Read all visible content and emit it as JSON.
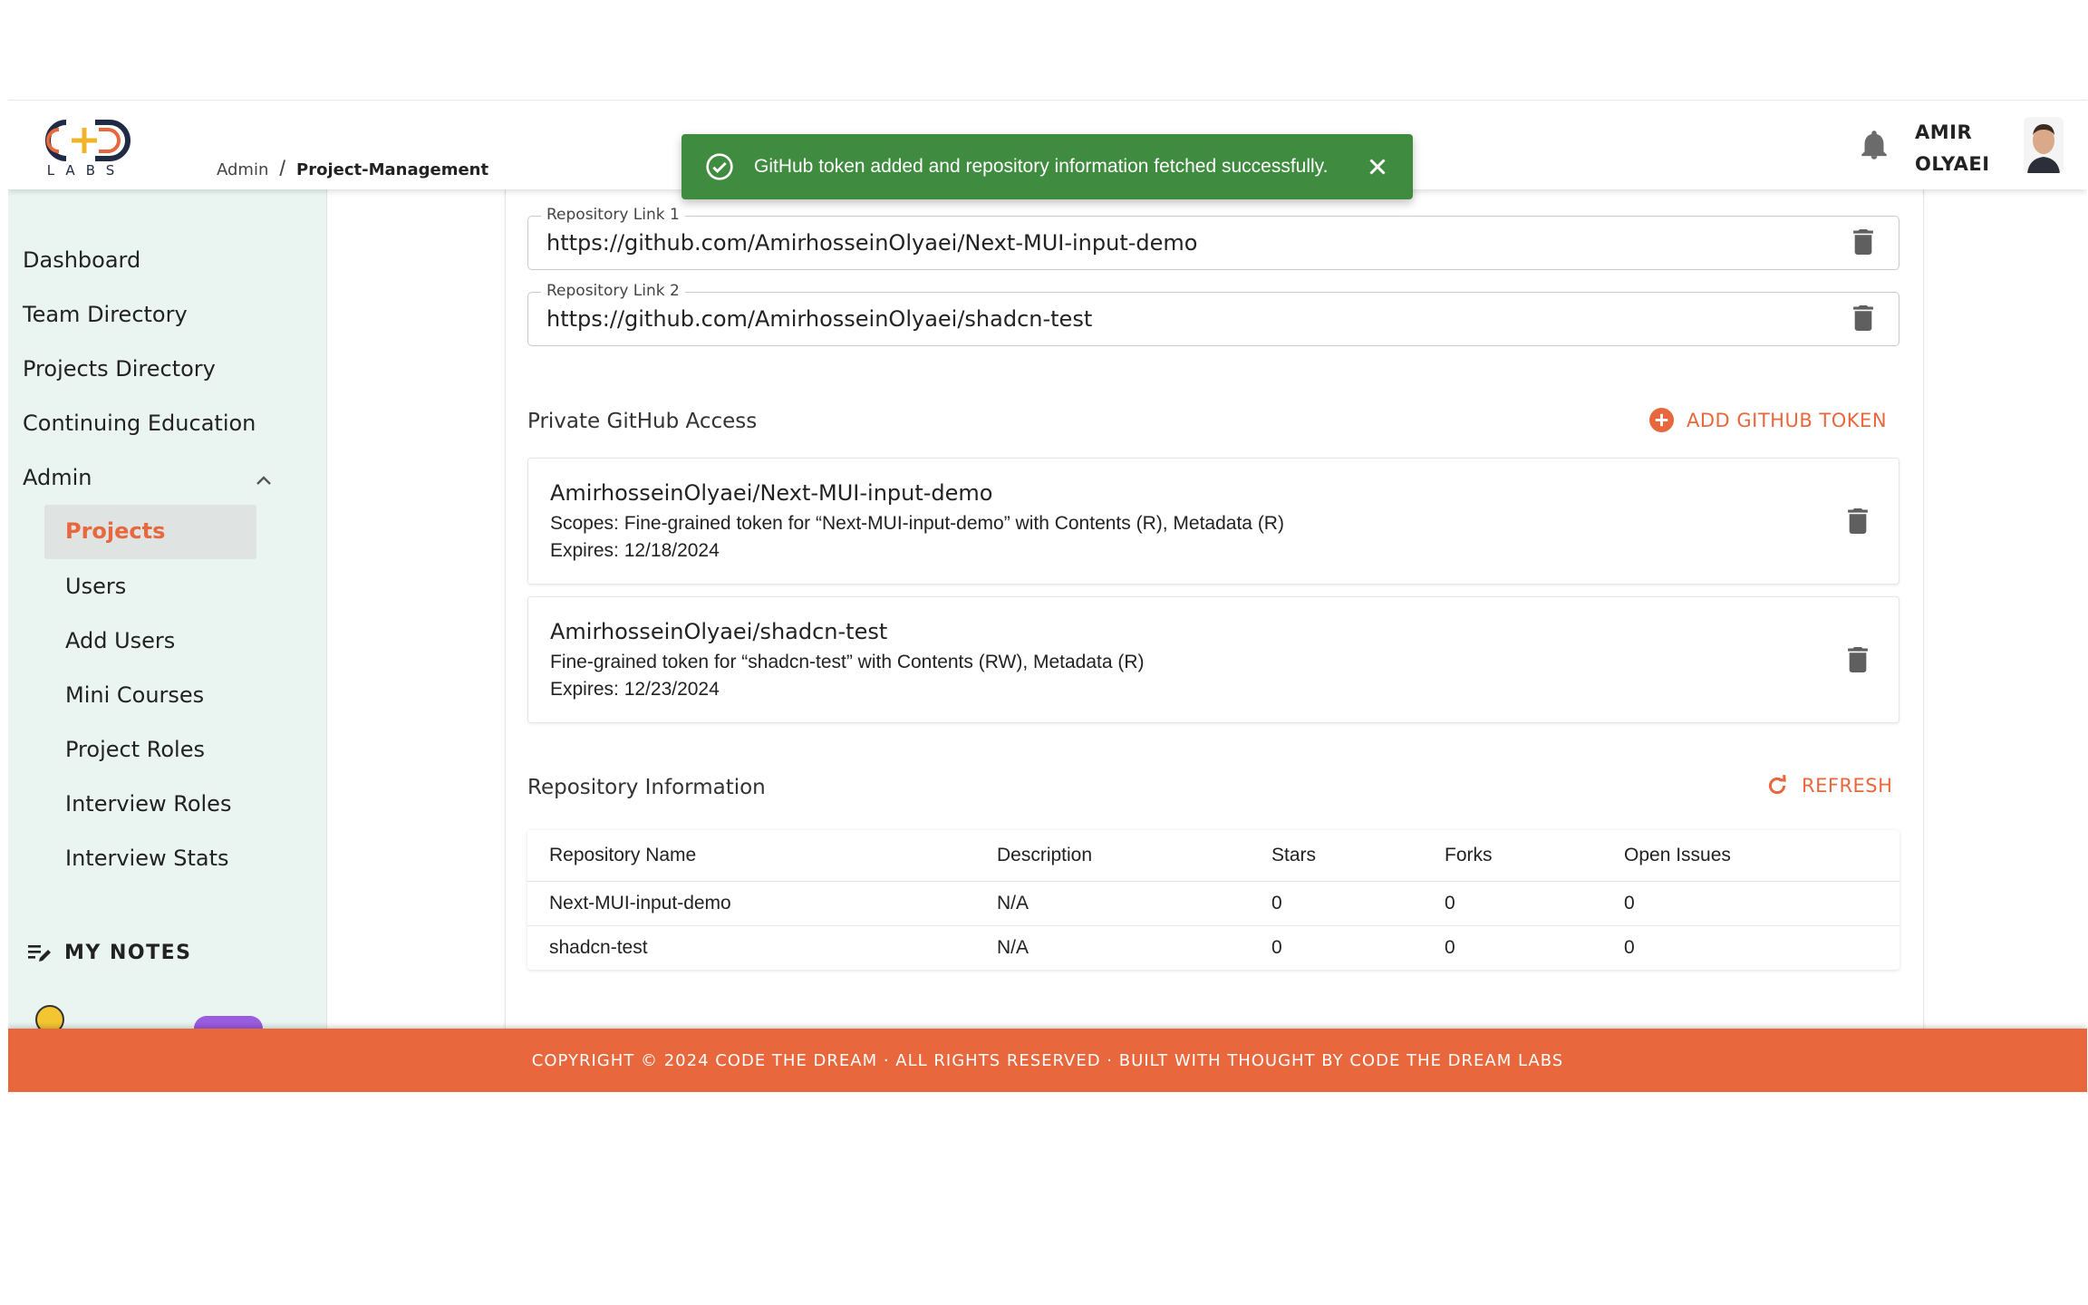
{
  "header": {
    "logo_text": "LABS",
    "breadcrumb": [
      "Admin",
      "Project-Management"
    ],
    "breadcrumb_separator": "/",
    "user_name": "AMIR OLYAEI"
  },
  "toast": {
    "message": "GitHub token added and repository information fetched successfully.",
    "color": "#3f8b3f"
  },
  "sidebar": {
    "items": [
      {
        "label": "Dashboard"
      },
      {
        "label": "Team Directory"
      },
      {
        "label": "Projects Directory"
      },
      {
        "label": "Continuing Education"
      },
      {
        "label": "Admin"
      }
    ],
    "admin_items": [
      {
        "label": "Projects",
        "active": true
      },
      {
        "label": "Users"
      },
      {
        "label": "Add Users"
      },
      {
        "label": "Mini Courses"
      },
      {
        "label": "Project Roles"
      },
      {
        "label": "Interview Roles"
      },
      {
        "label": "Interview Stats"
      }
    ],
    "notes_label": "MY NOTES"
  },
  "repo_links": [
    {
      "label": "Repository Link 1",
      "value": "https://github.com/AmirhosseinOlyaei/Next-MUI-input-demo"
    },
    {
      "label": "Repository Link 2",
      "value": "https://github.com/AmirhosseinOlyaei/shadcn-test"
    }
  ],
  "private_access": {
    "title": "Private GitHub Access",
    "add_button": "ADD GITHUB TOKEN",
    "tokens": [
      {
        "name": "AmirhosseinOlyaei/Next-MUI-input-demo",
        "scopes": "Scopes: Fine-grained token for “Next-MUI-input-demo” with Contents (R), Metadata (R)",
        "expires": "Expires: 12/18/2024"
      },
      {
        "name": "AmirhosseinOlyaei/shadcn-test",
        "scopes": "Fine-grained token for “shadcn-test” with Contents (RW), Metadata (R)",
        "expires": "Expires: 12/23/2024"
      }
    ]
  },
  "repo_info": {
    "title": "Repository Information",
    "refresh_button": "REFRESH",
    "columns": [
      "Repository Name",
      "Description",
      "Stars",
      "Forks",
      "Open Issues"
    ],
    "rows": [
      [
        "Next-MUI-input-demo",
        "N/A",
        "0",
        "0",
        "0"
      ],
      [
        "shadcn-test",
        "N/A",
        "0",
        "0",
        "0"
      ]
    ]
  },
  "footer": {
    "text": "COPYRIGHT © 2024 CODE THE DREAM · ALL RIGHTS RESERVED · BUILT WITH THOUGHT BY CODE THE DREAM LABS"
  },
  "colors": {
    "accent": "#e8673c",
    "sidebar_bg": "#eaf5f2",
    "success": "#3f8b3f"
  }
}
